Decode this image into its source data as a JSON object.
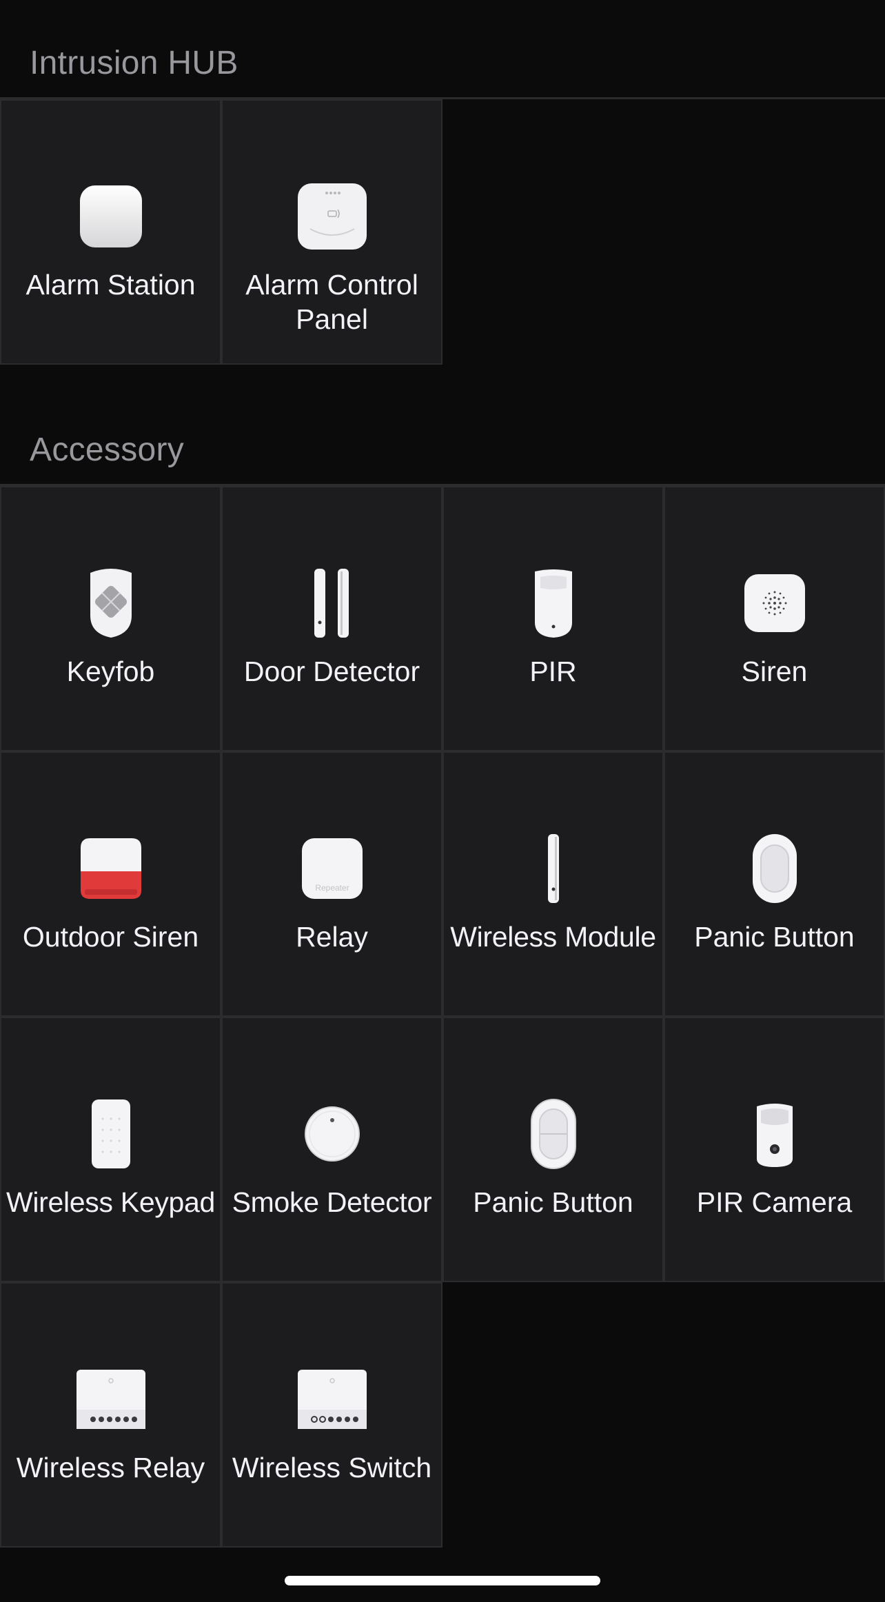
{
  "sections": [
    {
      "title": "Intrusion HUB",
      "items": [
        {
          "label": "Alarm Station",
          "icon": "alarm-station-icon"
        },
        {
          "label": "Alarm Control Panel",
          "icon": "alarm-control-panel-icon"
        }
      ]
    },
    {
      "title": "Accessory",
      "items": [
        {
          "label": "Keyfob",
          "icon": "keyfob-icon"
        },
        {
          "label": "Door Detector",
          "icon": "door-detector-icon"
        },
        {
          "label": "PIR",
          "icon": "pir-icon"
        },
        {
          "label": "Siren",
          "icon": "siren-icon"
        },
        {
          "label": "Outdoor Siren",
          "icon": "outdoor-siren-icon"
        },
        {
          "label": "Relay",
          "icon": "relay-icon",
          "icon_text": "Repeater"
        },
        {
          "label": "Wireless Module",
          "icon": "wireless-module-icon"
        },
        {
          "label": "Panic Button",
          "icon": "panic-button-icon"
        },
        {
          "label": "Wireless Keypad",
          "icon": "wireless-keypad-icon"
        },
        {
          "label": "Smoke Detector",
          "icon": "smoke-detector-icon"
        },
        {
          "label": "Panic Button",
          "icon": "panic-button-double-icon"
        },
        {
          "label": "PIR Camera",
          "icon": "pir-camera-icon"
        },
        {
          "label": "Wireless Relay",
          "icon": "wireless-relay-icon"
        },
        {
          "label": "Wireless Switch",
          "icon": "wireless-switch-icon"
        }
      ]
    }
  ],
  "colors": {
    "background": "#0b0b0c",
    "tile": "#1c1c1e",
    "tile_border": "#2c2c2e",
    "section_title": "#98989d",
    "siren_red": "#e03a3a"
  }
}
